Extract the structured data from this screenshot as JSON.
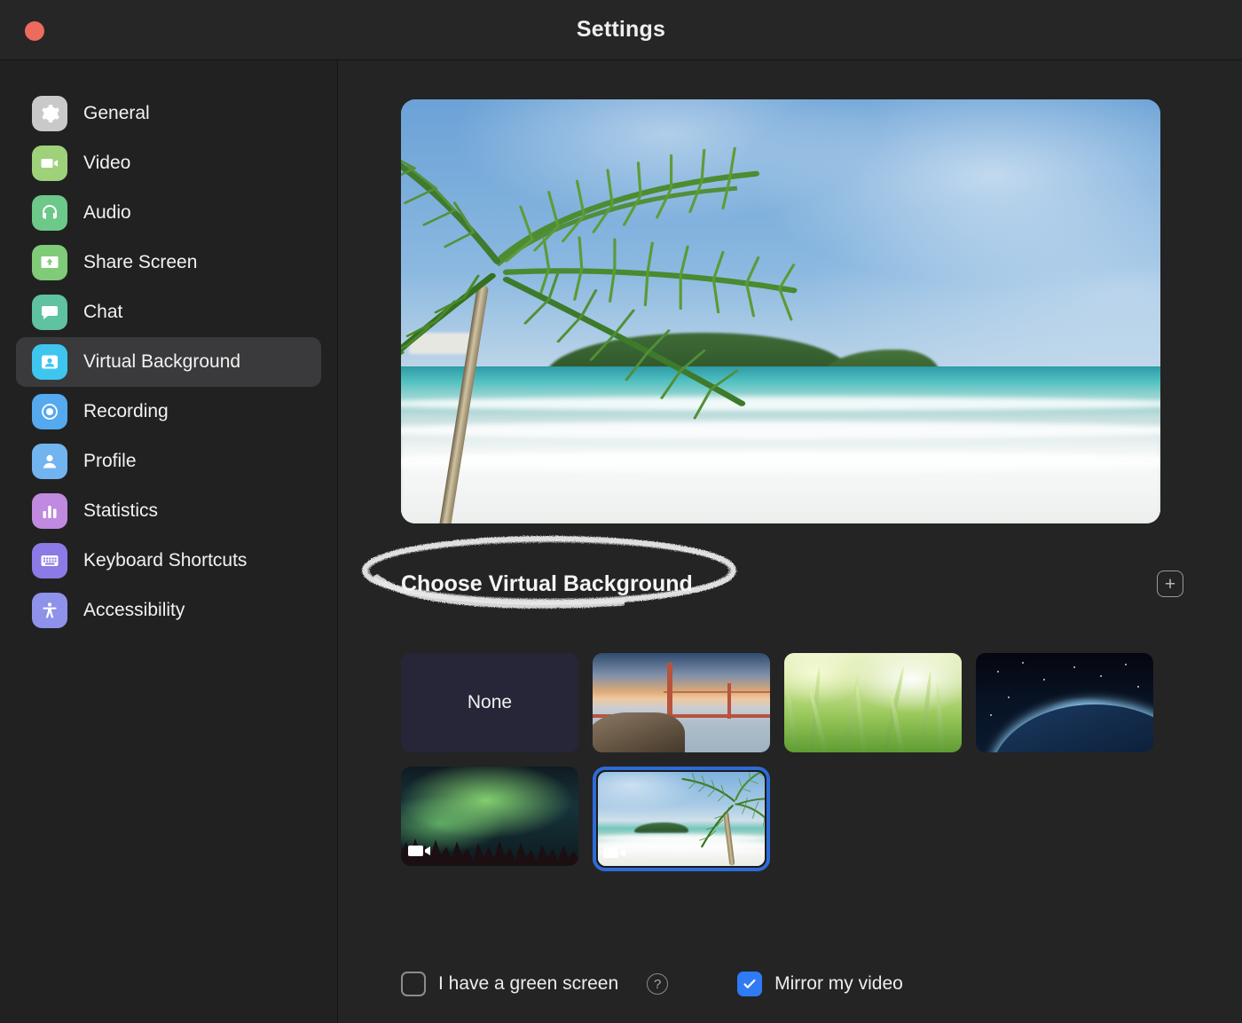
{
  "window": {
    "title": "Settings",
    "close_button": "close"
  },
  "sidebar": {
    "items": [
      {
        "label": "General",
        "icon": "gear-icon",
        "color": "#c9c9c9",
        "selected": false
      },
      {
        "label": "Video",
        "icon": "video-camera-icon",
        "color": "#9ed17a",
        "selected": false
      },
      {
        "label": "Audio",
        "icon": "headphones-icon",
        "color": "#6cc98a",
        "selected": false
      },
      {
        "label": "Share Screen",
        "icon": "share-screen-icon",
        "color": "#7fcb78",
        "selected": false
      },
      {
        "label": "Chat",
        "icon": "chat-bubble-icon",
        "color": "#5fc2a0",
        "selected": false
      },
      {
        "label": "Virtual Background",
        "icon": "virtual-background-icon",
        "color": "#3ec6ef",
        "selected": true
      },
      {
        "label": "Recording",
        "icon": "record-icon",
        "color": "#55a9ee",
        "selected": false
      },
      {
        "label": "Profile",
        "icon": "person-icon",
        "color": "#72b4f0",
        "selected": false
      },
      {
        "label": "Statistics",
        "icon": "bar-chart-icon",
        "color": "#c08ae0",
        "selected": false
      },
      {
        "label": "Keyboard Shortcuts",
        "icon": "keyboard-icon",
        "color": "#8c7ae6",
        "selected": false
      },
      {
        "label": "Accessibility",
        "icon": "accessibility-icon",
        "color": "#8f92ea",
        "selected": false
      }
    ]
  },
  "main": {
    "preview": {
      "name": "video-preview",
      "alt": "Tropical beach with palm tree, waves and island"
    },
    "section": {
      "heading": "Choose Virtual Background",
      "annotation": "hand-drawn-ellipse",
      "add_button_label": "+"
    },
    "backgrounds": [
      {
        "label": "None",
        "type": "none",
        "is_video": false,
        "selected": false
      },
      {
        "label": "Golden Gate Bridge",
        "type": "image",
        "is_video": false,
        "selected": false
      },
      {
        "label": "Grass",
        "type": "image",
        "is_video": false,
        "selected": false
      },
      {
        "label": "Earth from Space",
        "type": "image",
        "is_video": false,
        "selected": false
      },
      {
        "label": "Aurora Borealis",
        "type": "video",
        "is_video": true,
        "selected": false
      },
      {
        "label": "Tropical Beach",
        "type": "video",
        "is_video": true,
        "selected": true
      }
    ],
    "options": {
      "green_screen": {
        "label": "I have a green screen",
        "checked": false,
        "help": "?"
      },
      "mirror_video": {
        "label": "Mirror my video",
        "checked": true
      }
    }
  },
  "colors": {
    "window_bg": "#242424",
    "sidebar_bg": "#212121",
    "selected_nav": "#3a3a3c",
    "accent_blue": "#2f7bf6",
    "selection_border": "#2d6bd8",
    "close_red": "#ed6a5e",
    "none_tile": "#262638"
  }
}
